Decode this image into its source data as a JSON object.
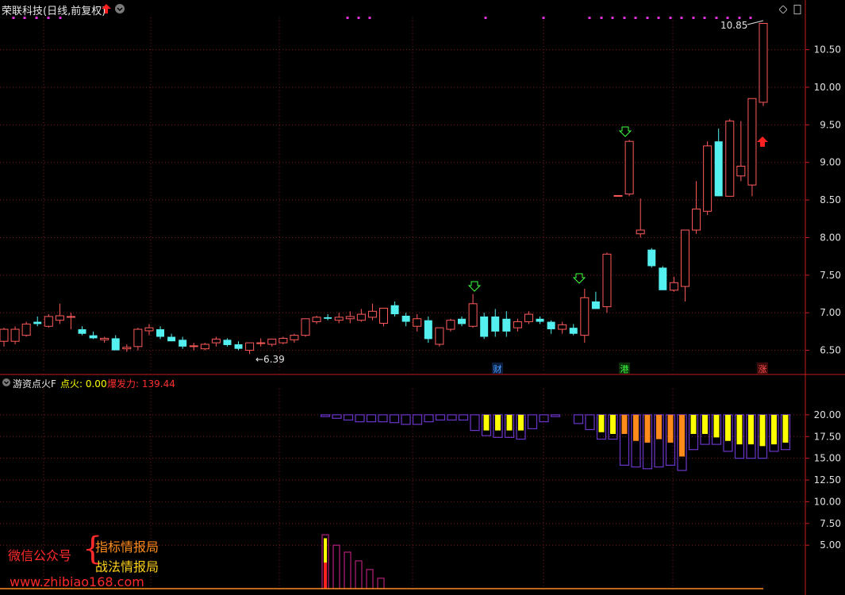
{
  "header": {
    "title": "荣联科技(日线,前复权)"
  },
  "indicator": {
    "name": "游资点火F",
    "dianhuo_label": "点火: 0.00",
    "baofa_label": "爆发力: 139.44"
  },
  "annotations": {
    "high_label": "10.85",
    "low_label": "←6.39",
    "tag_cai": "财",
    "tag_gang": "港",
    "tag_zhang": "涨"
  },
  "watermark": {
    "line1": "微信公众号",
    "line2": "指标情报局",
    "line3": "战法情报局",
    "url": "www.zhibiao168.com"
  },
  "colors": {
    "up": "#ff5a5a",
    "down": "#54f0f0",
    "grid": "#7a1a1a",
    "axis": "#c81e1e",
    "ind_purple": "#6a35c8",
    "ind_yellow": "#ffff00",
    "ind_orange": "#ff8c1a",
    "magenta": "#e030e0"
  },
  "chart_data": [
    {
      "type": "candlestick",
      "title": "荣联科技(日线,前复权)",
      "ylim": [
        6.2,
        10.95
      ],
      "yticks": [
        "10.50",
        "10.00",
        "9.50",
        "9.00",
        "8.50",
        "8.00",
        "7.50",
        "7.00",
        "6.50"
      ],
      "ohlc": [
        [
          6.62,
          6.8,
          6.55,
          6.78
        ],
        [
          6.62,
          6.82,
          6.58,
          6.78
        ],
        [
          6.7,
          6.88,
          6.68,
          6.85
        ],
        [
          6.88,
          6.95,
          6.82,
          6.85
        ],
        [
          6.82,
          6.98,
          6.8,
          6.95
        ],
        [
          6.9,
          7.12,
          6.85,
          6.96
        ],
        [
          6.95,
          7.0,
          6.78,
          6.95
        ],
        [
          6.78,
          6.82,
          6.7,
          6.72
        ],
        [
          6.7,
          6.75,
          6.65,
          6.66
        ],
        [
          6.64,
          6.68,
          6.6,
          6.66
        ],
        [
          6.66,
          6.7,
          6.6,
          6.5
        ],
        [
          6.52,
          6.58,
          6.48,
          6.54
        ],
        [
          6.55,
          6.8,
          6.5,
          6.78
        ],
        [
          6.76,
          6.85,
          6.7,
          6.8
        ],
        [
          6.78,
          6.82,
          6.65,
          6.68
        ],
        [
          6.68,
          6.72,
          6.62,
          6.62
        ],
        [
          6.64,
          6.68,
          6.52,
          6.55
        ],
        [
          6.56,
          6.6,
          6.5,
          6.56
        ],
        [
          6.52,
          6.6,
          6.5,
          6.58
        ],
        [
          6.6,
          6.68,
          6.55,
          6.65
        ],
        [
          6.64,
          6.66,
          6.55,
          6.57
        ],
        [
          6.58,
          6.62,
          6.5,
          6.52
        ],
        [
          6.5,
          6.6,
          6.45,
          6.6
        ],
        [
          6.6,
          6.66,
          6.55,
          6.6
        ],
        [
          6.58,
          6.65,
          6.55,
          6.65
        ],
        [
          6.6,
          6.68,
          6.58,
          6.66
        ],
        [
          6.64,
          6.72,
          6.6,
          6.7
        ],
        [
          6.7,
          6.92,
          6.68,
          6.92
        ],
        [
          6.88,
          6.96,
          6.85,
          6.94
        ],
        [
          6.94,
          6.98,
          6.9,
          6.92
        ],
        [
          6.9,
          7.0,
          6.86,
          6.94
        ],
        [
          6.92,
          7.02,
          6.86,
          6.95
        ],
        [
          6.9,
          7.05,
          6.88,
          6.98
        ],
        [
          6.94,
          7.12,
          6.9,
          7.02
        ],
        [
          6.86,
          7.05,
          6.82,
          7.06
        ],
        [
          7.1,
          7.15,
          6.95,
          6.98
        ],
        [
          6.96,
          7.0,
          6.82,
          6.88
        ],
        [
          6.82,
          6.98,
          6.75,
          6.92
        ],
        [
          6.9,
          6.95,
          6.6,
          6.65
        ],
        [
          6.58,
          6.8,
          6.55,
          6.8
        ],
        [
          6.78,
          6.92,
          6.75,
          6.9
        ],
        [
          6.92,
          6.95,
          6.82,
          6.85
        ],
        [
          6.82,
          7.25,
          6.8,
          7.12
        ],
        [
          6.95,
          7.0,
          6.65,
          6.68
        ],
        [
          6.95,
          7.05,
          6.68,
          6.75
        ],
        [
          6.92,
          7.02,
          6.68,
          6.75
        ],
        [
          6.8,
          6.92,
          6.75,
          6.88
        ],
        [
          6.88,
          7.02,
          6.85,
          6.98
        ],
        [
          6.92,
          6.95,
          6.85,
          6.88
        ],
        [
          6.88,
          6.9,
          6.72,
          6.78
        ],
        [
          6.78,
          6.88,
          6.72,
          6.84
        ],
        [
          6.8,
          6.85,
          6.7,
          6.72
        ],
        [
          6.7,
          7.32,
          6.6,
          7.2
        ],
        [
          7.15,
          7.28,
          7.05,
          7.05
        ],
        [
          7.08,
          7.8,
          7.0,
          7.78
        ],
        [
          8.55,
          8.56,
          8.55,
          8.56
        ],
        [
          8.58,
          9.3,
          8.55,
          9.28
        ],
        [
          8.05,
          8.52,
          8.0,
          8.1
        ],
        [
          7.84,
          7.86,
          7.6,
          7.62
        ],
        [
          7.6,
          7.62,
          7.3,
          7.3
        ],
        [
          7.3,
          7.48,
          7.28,
          7.4
        ],
        [
          7.35,
          8.1,
          7.15,
          8.1
        ],
        [
          8.1,
          8.75,
          8.05,
          8.38
        ],
        [
          8.35,
          9.28,
          8.3,
          9.22
        ],
        [
          9.28,
          9.45,
          8.55,
          8.55
        ],
        [
          8.55,
          9.58,
          8.55,
          9.55
        ],
        [
          8.82,
          9.55,
          8.75,
          8.95
        ],
        [
          8.7,
          9.6,
          8.55,
          9.85
        ],
        [
          9.8,
          10.85,
          9.75,
          10.85
        ]
      ]
    },
    {
      "type": "bar",
      "title": "游资点火F",
      "ylim": [
        0,
        23
      ],
      "yticks": [
        "20.00",
        "17.50",
        "15.00",
        "12.50",
        "10.00",
        "7.50",
        "5.00"
      ],
      "bars": [
        [
          19.8,
          19.8,
          0
        ],
        [
          19.6,
          19.6,
          0
        ],
        [
          19.4,
          19.4,
          0
        ],
        [
          19.2,
          19.2,
          0
        ],
        [
          19.2,
          19.2,
          0
        ],
        [
          19.2,
          19.2,
          0
        ],
        [
          19.1,
          19.1,
          0
        ],
        [
          18.9,
          18.9,
          0
        ],
        [
          18.9,
          18.9,
          0
        ],
        [
          19.2,
          19.2,
          0
        ],
        [
          19.4,
          19.4,
          0
        ],
        [
          19.4,
          19.4,
          0
        ],
        [
          19.4,
          19.4,
          0
        ],
        [
          18.2,
          18.2,
          0
        ],
        [
          17.6,
          18.2,
          1
        ],
        [
          17.4,
          18.2,
          1
        ],
        [
          17.4,
          18.2,
          1
        ],
        [
          17.2,
          18.2,
          1
        ],
        [
          18.4,
          18.4,
          0
        ],
        [
          19.2,
          19.2,
          0
        ],
        [
          19.8,
          19.8,
          0
        ],
        [
          -1,
          -1,
          -1
        ],
        [
          19.0,
          19.0,
          0
        ],
        [
          18.3,
          18.3,
          0
        ],
        [
          17.2,
          18.0,
          1
        ],
        [
          17.2,
          17.8,
          1
        ],
        [
          14.2,
          17.8,
          2
        ],
        [
          14.0,
          17.0,
          2
        ],
        [
          13.8,
          16.8,
          2
        ],
        [
          14.0,
          17.2,
          2
        ],
        [
          14.2,
          16.8,
          2
        ],
        [
          13.6,
          15.2,
          2
        ],
        [
          16.0,
          17.8,
          1
        ],
        [
          16.6,
          17.8,
          1
        ],
        [
          16.6,
          17.4,
          1
        ],
        [
          15.8,
          17.0,
          1
        ],
        [
          15.0,
          16.6,
          1
        ],
        [
          15.0,
          16.6,
          1
        ],
        [
          15.0,
          16.4,
          1
        ],
        [
          15.8,
          16.6,
          1
        ],
        [
          16.0,
          16.8,
          1
        ]
      ],
      "lower_bars": [
        6.2,
        5.0,
        4.2,
        3.2,
        2.2,
        1.2
      ],
      "triangle": [
        [
          0.0,
          0.0
        ],
        [
          7.0,
          0.0
        ],
        [
          0.0,
          0.0
        ]
      ]
    }
  ]
}
